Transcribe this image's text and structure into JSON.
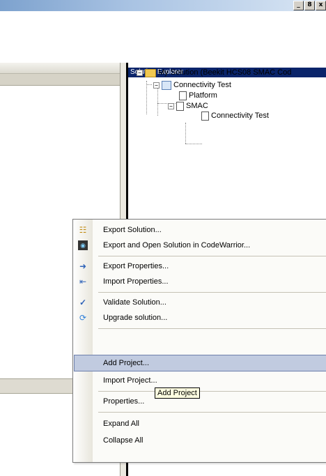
{
  "window": {
    "minimize_glyph": "_",
    "restore_glyph": "8",
    "close_glyph": "x"
  },
  "solution_explorer": {
    "title": "Solution Explorer",
    "tree": {
      "solution": "My Solution (Beekit HCS08 SMAC Cod",
      "project": "Connectivity Test",
      "platform": "Platform",
      "smac": "SMAC",
      "smac_child": "Connectivity Test"
    },
    "expander_minus": "−"
  },
  "context_menu": {
    "export_solution": "Export Solution...",
    "export_open_cw": "Export and Open Solution in CodeWarrior...",
    "export_properties": "Export Properties...",
    "import_properties": "Import Properties...",
    "validate_solution": "Validate Solution...",
    "upgrade_solution": "Upgrade solution...",
    "add_project": "Add Project...",
    "import_project": "Import Project...",
    "properties": "Properties...",
    "expand_all": "Expand All",
    "collapse_all": "Collapse All"
  },
  "tooltip": {
    "text": "Add Project"
  },
  "icons": {
    "export_solution": "export-solution-icon",
    "export_cw": "codewarrior-icon",
    "export_properties": "export-properties-icon",
    "import_properties": "import-properties-icon",
    "validate": "checkmark-icon",
    "upgrade": "upgrade-icon"
  },
  "colors": {
    "highlight": "#c1cbe0",
    "explorer_header": "#0a246a",
    "tooltip_bg": "#ffffe1"
  }
}
